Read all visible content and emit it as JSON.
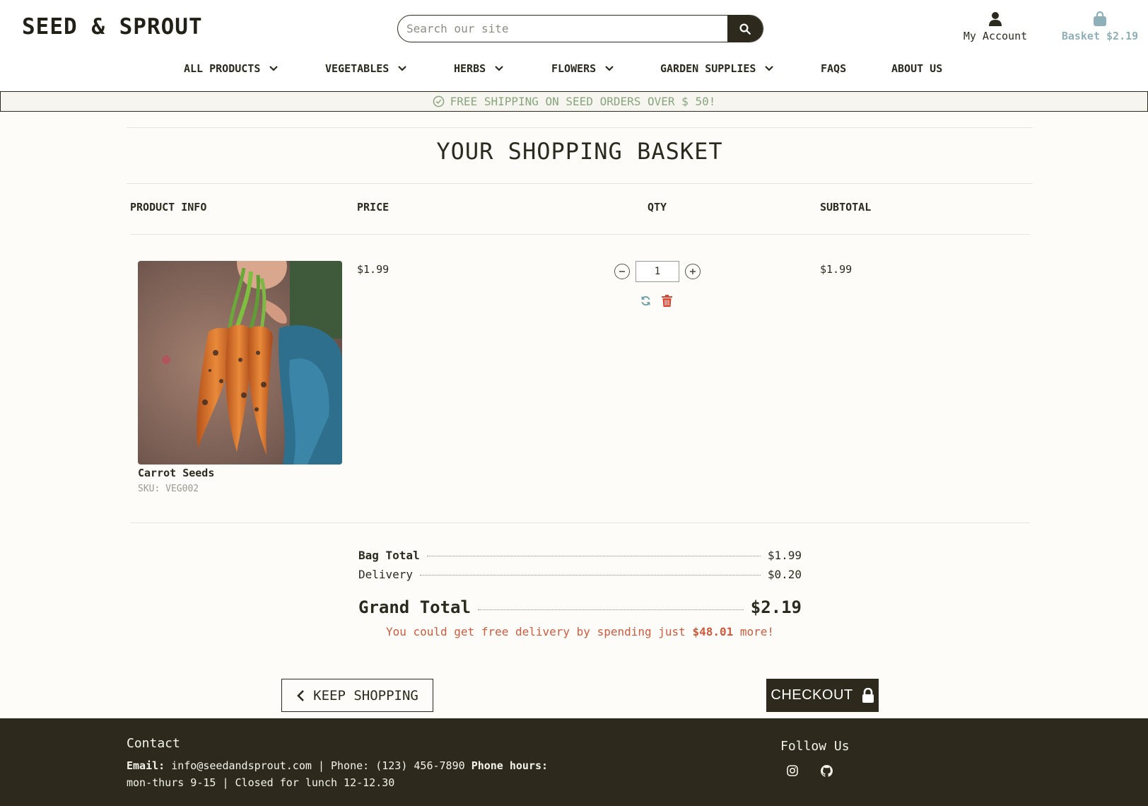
{
  "header": {
    "logo": "SEED & SPROUT",
    "search_placeholder": "Search our site",
    "account_label": "My Account",
    "basket_label": "Basket $2.19"
  },
  "nav": {
    "items": [
      {
        "label": "ALL PRODUCTS",
        "has_dropdown": true
      },
      {
        "label": "VEGETABLES",
        "has_dropdown": true
      },
      {
        "label": "HERBS",
        "has_dropdown": true
      },
      {
        "label": "FLOWERS",
        "has_dropdown": true
      },
      {
        "label": "GARDEN SUPPLIES",
        "has_dropdown": true
      },
      {
        "label": "FAQS",
        "has_dropdown": false
      },
      {
        "label": "ABOUT US",
        "has_dropdown": false
      }
    ]
  },
  "banner": {
    "text": "FREE SHIPPING ON SEED ORDERS OVER $ 50!"
  },
  "basket": {
    "title": "YOUR SHOPPING BASKET",
    "columns": [
      "PRODUCT INFO",
      "PRICE",
      "QTY",
      "SUBTOTAL"
    ],
    "items": [
      {
        "name": "Carrot Seeds",
        "sku": "SKU: VEG002",
        "price": "$1.99",
        "qty": "1",
        "subtotal": "$1.99"
      }
    ]
  },
  "totals": {
    "bag_total_label": "Bag Total",
    "bag_total_value": "$1.99",
    "delivery_label": "Delivery",
    "delivery_value": "$0.20",
    "grand_total_label": "Grand Total",
    "grand_total_value": "$2.19",
    "free_delivery_prefix": "You could get free delivery by spending just",
    "free_delivery_amount": "$48.01",
    "free_delivery_suffix": "more!"
  },
  "buttons": {
    "keep_shopping": "KEEP SHOPPING",
    "checkout": "CHECKOUT"
  },
  "footer": {
    "contact_heading": "Contact",
    "email_label": "Email:",
    "email_value": "info@seedandsprout.com",
    "phone_text": "| Phone: (123) 456-7890",
    "phone_hours_label": "Phone hours:",
    "hours_text": "mon-thurs 9-15 | Closed for lunch 12-12.30",
    "follow_heading": "Follow Us"
  },
  "colors": {
    "dark": "#2d2a1d",
    "background": "#fdfcf8",
    "banner_text": "#89a57e",
    "basket_accent": "#8fb0b8",
    "alert_red": "#d05a3e"
  },
  "icons": [
    "search-icon",
    "user-icon",
    "shopping-bag-icon",
    "chevron-down-icon",
    "check-circle-icon",
    "minus-circle-icon",
    "plus-circle-icon",
    "refresh-icon",
    "trash-icon",
    "chevron-left-icon",
    "lock-icon",
    "instagram-icon",
    "github-icon"
  ]
}
